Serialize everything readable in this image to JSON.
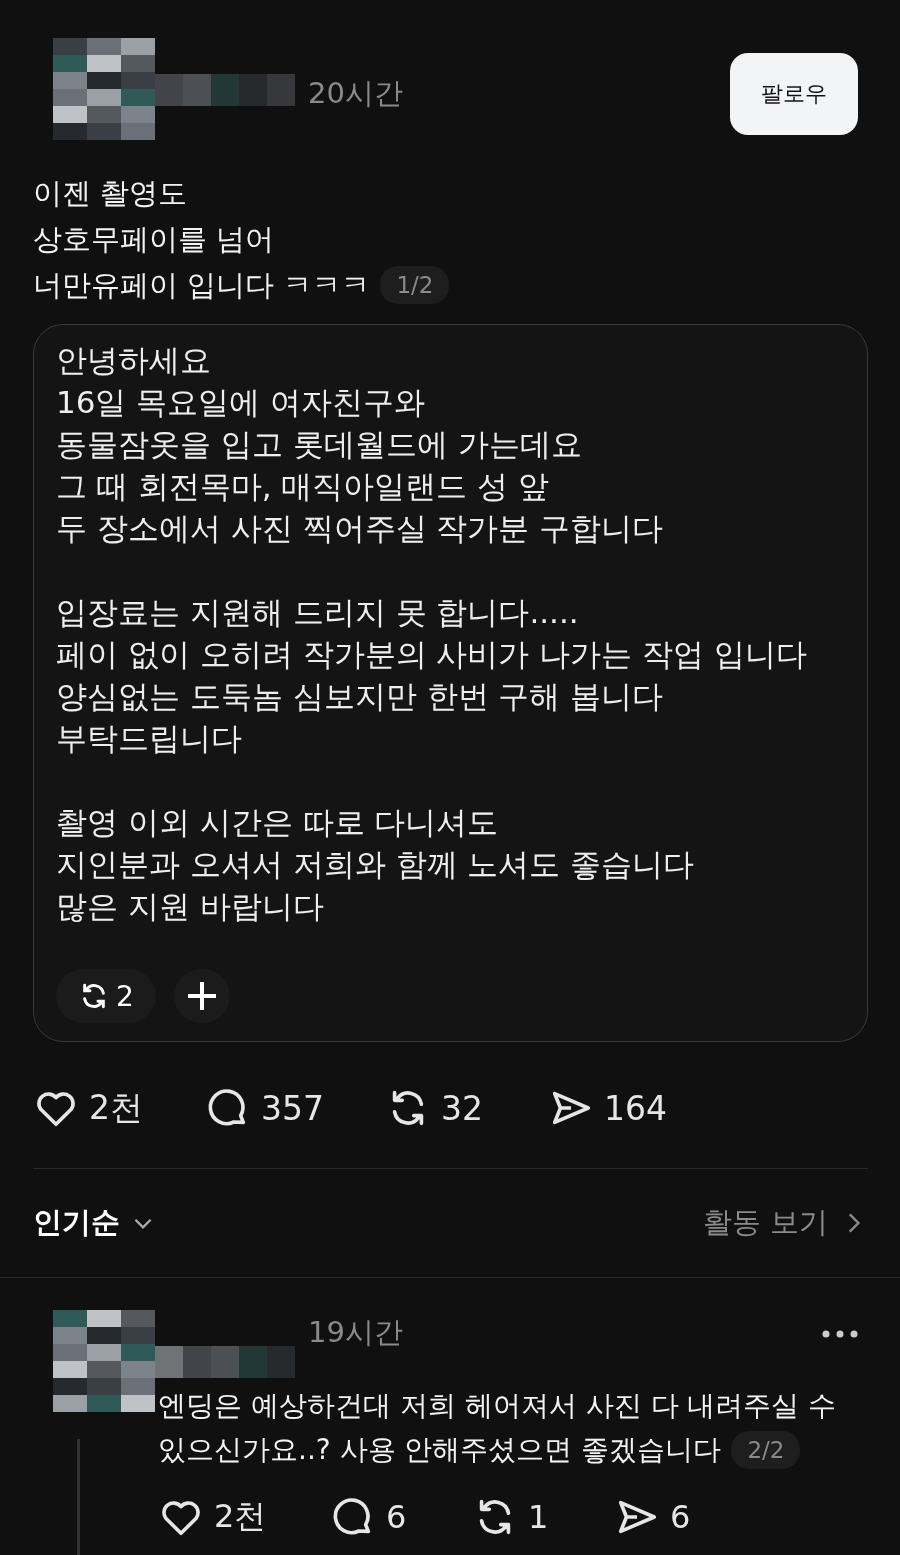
{
  "post": {
    "time": "20시간",
    "follow_button": "팔로우",
    "text_lines": [
      "이젠 촬영도",
      "상호무페이를 넘어",
      "너만유페이 입니다 ㅋㅋㅋ"
    ],
    "page_indicator": "1/2",
    "image": {
      "paragraphs": [
        [
          "안녕하세요",
          "16일 목요일에 여자친구와",
          "동물잠옷을 입고 롯데월드에 가는데요",
          "그 때 회전목마, 매직아일랜드 성 앞",
          "두 장소에서 사진 찍어주실 작가분 구합니다"
        ],
        [
          "입장료는 지원해 드리지 못 합니다.....",
          "페이 없이 오히려 작가분의 사비가 나가는 작업 입니다",
          "양심없는 도둑놈 심보지만 한번 구해 봅니다",
          "부탁드립니다"
        ],
        [
          "촬영 이외 시간은 따로 다니셔도",
          "지인분과 오셔서 저희와 함께 노셔도 좋습니다",
          "많은 지원 바랍니다"
        ]
      ],
      "repost_count": "2"
    },
    "actions": [
      {
        "kind": "like",
        "count": "2천"
      },
      {
        "kind": "reply",
        "count": "357"
      },
      {
        "kind": "repost",
        "count": "32"
      },
      {
        "kind": "share",
        "count": "164"
      }
    ]
  },
  "sort": {
    "label": "인기순",
    "activity_link": "활동 보기"
  },
  "comment": {
    "time": "19시간",
    "text_lines": [
      "엔딩은 예상하건대 저희 헤어져서 사진 다 내려주실 수",
      "있으신가요..? 사용 안해주셨으면 좋겠습니다"
    ],
    "page_indicator": "2/2",
    "actions": [
      {
        "kind": "like",
        "count": "2천"
      },
      {
        "kind": "reply",
        "count": "6"
      },
      {
        "kind": "repost",
        "count": "1"
      },
      {
        "kind": "share",
        "count": "6"
      }
    ]
  }
}
